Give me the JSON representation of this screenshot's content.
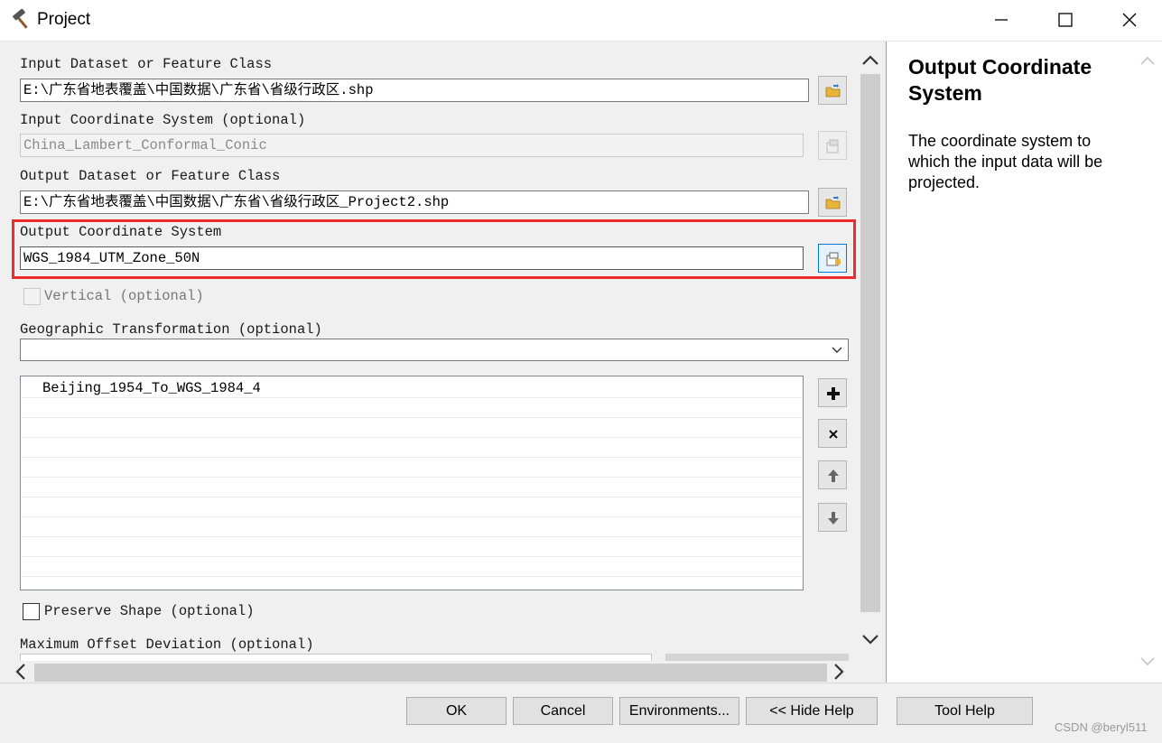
{
  "window": {
    "title": "Project",
    "icon": "hammer-icon",
    "controls": [
      "minimize-icon",
      "maximize-icon",
      "close-icon"
    ]
  },
  "form": {
    "input_dataset": {
      "label": "Input Dataset or Feature Class",
      "value": "E:\\广东省地表覆盖\\中国数据\\广东省\\省级行政区.shp",
      "button_icon": "open-folder-icon"
    },
    "input_coord": {
      "label": "Input Coordinate System (optional)",
      "value": "China_Lambert_Conformal_Conic",
      "button_icon": "properties-icon"
    },
    "output_dataset": {
      "label": "Output Dataset or Feature Class",
      "value": "E:\\广东省地表覆盖\\中国数据\\广东省\\省级行政区_Project2.shp",
      "button_icon": "open-folder-icon"
    },
    "output_coord": {
      "label": "Output Coordinate System",
      "value": "WGS_1984_UTM_Zone_50N",
      "button_icon": "properties-icon"
    },
    "vertical": {
      "label": "Vertical (optional)",
      "checked": false
    },
    "geo_transform": {
      "label": "Geographic Transformation (optional)",
      "value": "",
      "list": [
        "Beijing_1954_To_WGS_1984_4"
      ],
      "buttons": [
        "add-icon",
        "remove-icon",
        "move-up-icon",
        "move-down-icon"
      ]
    },
    "preserve_shape": {
      "label": "Preserve Shape (optional)",
      "checked": false
    },
    "max_offset": {
      "label": "Maximum Offset Deviation (optional)"
    }
  },
  "help": {
    "title": "Output Coordinate System",
    "body": "The coordinate system to which the input data will be projected."
  },
  "buttons": {
    "ok": "OK",
    "cancel": "Cancel",
    "environments": "Environments...",
    "hide_help": "<< Hide Help",
    "tool_help": "Tool Help"
  },
  "watermark": "CSDN @beryl511",
  "colors": {
    "highlight": "#ee2c2c",
    "accent": "#0078d7",
    "folder": "#e8b53a"
  }
}
